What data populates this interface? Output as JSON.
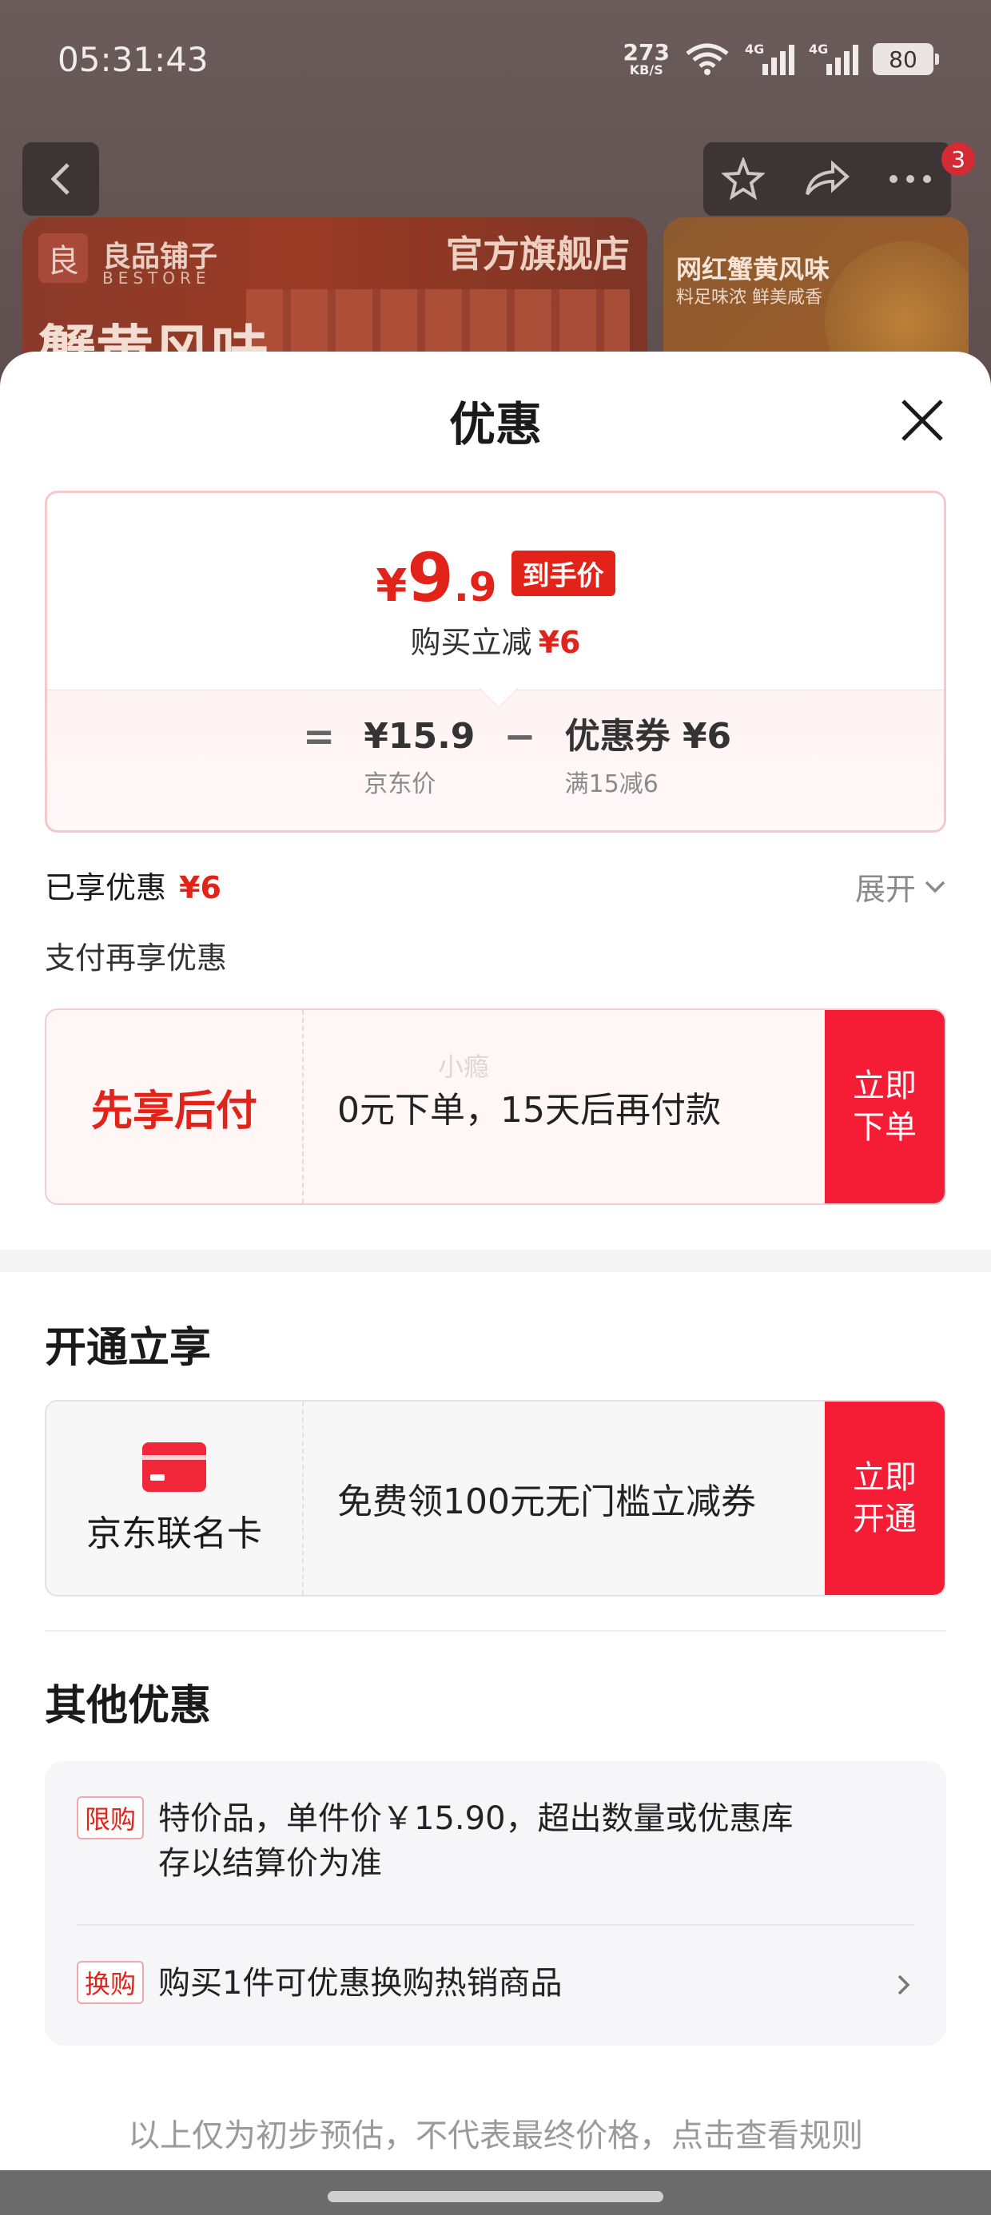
{
  "status_bar": {
    "time": "05:31:43",
    "net_speed": "273",
    "net_unit": "KB/S",
    "sim1": "4G",
    "sim2": "4G",
    "battery": "80"
  },
  "background_page": {
    "header_badge": "3",
    "banner_main": {
      "brand_cn": "良品铺子",
      "brand_en": "BESTORE",
      "flagship": "官方旗舰店",
      "headline": "蟹黄风味"
    },
    "banner_side": {
      "title": "网红蟹黄风味",
      "subtitle": "料足味浓 鲜美咸香"
    }
  },
  "sheet": {
    "title": "优惠",
    "price_card": {
      "currency": "¥",
      "final_int": "9",
      "final_dec": ".9",
      "final_tag": "到手价",
      "saving_label": "购买立减",
      "saving_amount": "¥6",
      "equals": "=",
      "minus": "−",
      "jd_price": "¥15.9",
      "jd_price_label": "京东价",
      "coupon": "优惠券 ¥6",
      "coupon_rule": "满15减6"
    },
    "enjoyed_label": "已享优惠",
    "enjoyed_amount": "¥6",
    "expand_label": "展开",
    "pay_more_label": "支付再享优惠",
    "pay_offer": {
      "title": "先享后付",
      "desc": "0元下单，15天后再付款",
      "button": "立即下单",
      "watermark": "小瘾"
    },
    "open_section_title": "开通立享",
    "card_offer": {
      "name": "京东联名卡",
      "desc": "免费领100元无门槛立减券",
      "button": "立即开通"
    },
    "other_section_title": "其他优惠",
    "other_promos": [
      {
        "tag": "限购",
        "text": "特价品，单件价￥15.90，超出数量或优惠库存以结算价为准"
      },
      {
        "tag": "换购",
        "text": "购买1件可优惠换购热销商品"
      }
    ],
    "footnote": "以上仅为初步预估，不代表最终价格，点击查看规则"
  },
  "colors": {
    "accent_red": "#e2231a",
    "button_red": "#f51c35"
  },
  "icons": [
    "back-icon",
    "star-icon",
    "share-icon",
    "more-icon",
    "close-icon",
    "chevron-down-icon",
    "card-icon",
    "chevron-right-icon",
    "wifi-icon"
  ]
}
